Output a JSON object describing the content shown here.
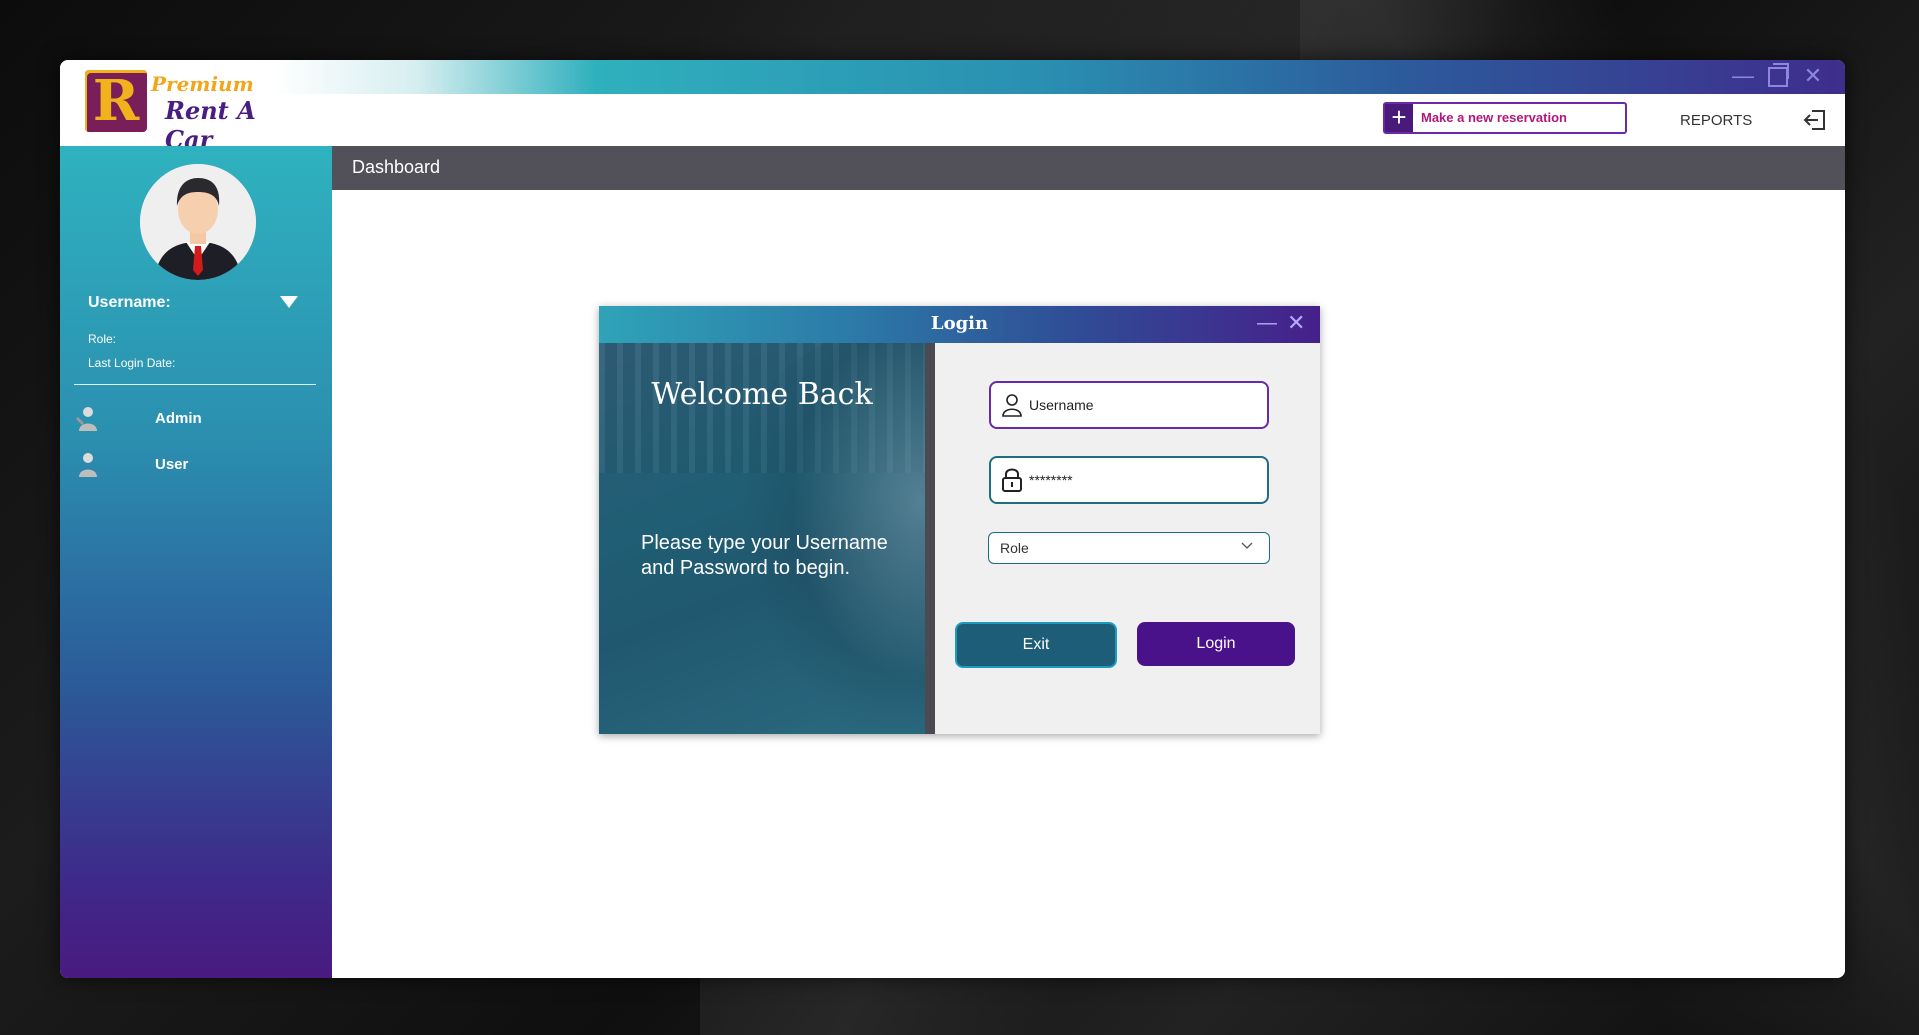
{
  "app": {
    "logo": {
      "letter": "R",
      "line1": "Premium",
      "line2": "Rent A Car"
    },
    "window_controls": {
      "minimize": "—",
      "close": "✕"
    }
  },
  "toolbar": {
    "reserve_plus": "+",
    "reserve_label": "Make a new reservation",
    "reports_label": "REPORTS",
    "logout_icon": "logout-icon"
  },
  "sidebar": {
    "username_label": "Username:",
    "role_label": "Role:",
    "last_login_label": "Last Login Date:",
    "items": [
      {
        "label": "Admin",
        "icon": "admin-icon"
      },
      {
        "label": "User",
        "icon": "user-icon"
      }
    ]
  },
  "main": {
    "title": "Dashboard"
  },
  "login_dialog": {
    "title": "Login",
    "minimize": "—",
    "close": "✕",
    "welcome": "Welcome Back",
    "prompt": "Please type your Username and Password to begin.",
    "username_value": "Username",
    "password_value": "********",
    "role_value": "Role",
    "exit_label": "Exit",
    "login_label": "Login"
  },
  "colors": {
    "sidebar_top": "#2fb2bf",
    "sidebar_bottom": "#4a1a80",
    "header_bar": "#525059",
    "accent_purple": "#4a128a",
    "accent_teal": "#1e5d78"
  }
}
